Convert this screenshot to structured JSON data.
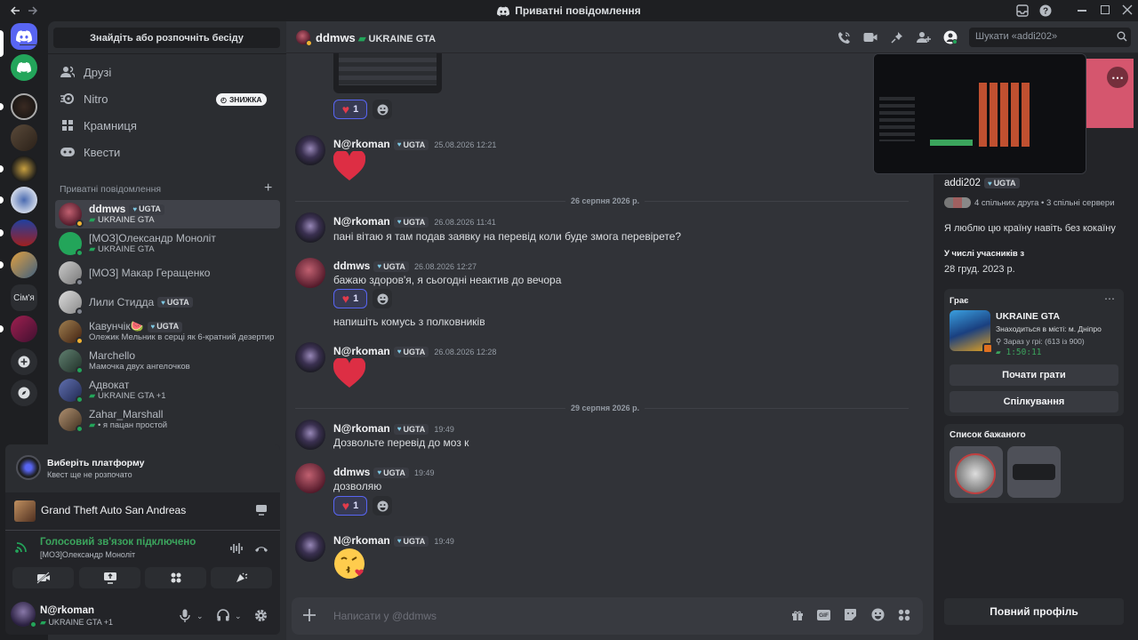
{
  "window": {
    "title": "Приватні повідомлення"
  },
  "sidebar": {
    "search_label": "Знайдіть або розпочніть бесіду",
    "nav": [
      {
        "label": "Друзі",
        "icon": "friends-icon"
      },
      {
        "label": "Nitro",
        "icon": "nitro-icon",
        "badge": "ЗНИЖКА"
      },
      {
        "label": "Крамниця",
        "icon": "shop-icon"
      },
      {
        "label": "Квести",
        "icon": "quests-icon"
      }
    ],
    "dm_header": "Приватні повідомлення",
    "dm_list": [
      {
        "name": "ddmws",
        "tag": "UGTA",
        "sub": "UKRAINE GTA"
      },
      {
        "name": "[МОЗ]Олександр Моноліт",
        "sub": "UKRAINE GTA"
      },
      {
        "name": "[МОЗ] Макар Геращенко"
      },
      {
        "name": "Лили Стидда",
        "tag": "UGTA"
      },
      {
        "name": "Кавунчік🍉",
        "tag": "UGTA",
        "sub": "Олежик Мельник в серці як 6-кратний дезертир"
      },
      {
        "name": "Marchello",
        "sub": "Мамочка двух ангелочков"
      },
      {
        "name": "Адвокат",
        "sub": "UKRAINE GTA +1"
      },
      {
        "name": "Zahar_Marshall",
        "sub": "• я пацан простой"
      }
    ],
    "quest": {
      "title": "Виберіть платформу",
      "sub": "Квест ще не розпочато"
    },
    "game": {
      "title": "Grand Theft Auto San Andreas"
    },
    "voice": {
      "status": "Голосовий зв'язок підключено",
      "channel": "[МОЗ]Олександр Моноліт"
    },
    "user": {
      "name": "N@rkoman",
      "sub": "UKRAINE GTA +1"
    }
  },
  "guilds": {
    "folder_label": "Сім'я"
  },
  "header": {
    "name": "ddmws",
    "activity": "UKRAINE GTA",
    "search_placeholder": "Шукати «addi202»"
  },
  "messages": {
    "m1": {
      "author": "N@rkoman",
      "tag": "UGTA",
      "time": "25.08.2026 12:21"
    },
    "div1": "26 серпня 2026 р.",
    "m2": {
      "author": "N@rkoman",
      "tag": "UGTA",
      "time": "26.08.2026 11:41",
      "text": "пані вітаю я там подав заявку на перевід коли буде змога перевірете?"
    },
    "m3": {
      "author": "ddmws",
      "tag": "UGTA",
      "time": "26.08.2026 12:27",
      "text": "бажаю здоров'я, я сьогодні неактив до вечора",
      "text2": "напишіть комусь з полковників"
    },
    "m4": {
      "author": "N@rkoman",
      "tag": "UGTA",
      "time": "26.08.2026 12:28"
    },
    "div2": "29 серпня 2026 р.",
    "m5": {
      "author": "N@rkoman",
      "tag": "UGTA",
      "time": "19:49",
      "text": "Дозвольте перевід до моз к"
    },
    "m6": {
      "author": "ddmws",
      "tag": "UGTA",
      "time": "19:49",
      "text": "дозволяю"
    },
    "m7": {
      "author": "N@rkoman",
      "tag": "UGTA",
      "time": "19:49"
    },
    "reaction_count": "1"
  },
  "composer": {
    "placeholder": "Написати у @ddmws"
  },
  "profile": {
    "username": "addi202",
    "tag": "UGTA",
    "mutuals": "4 спільних друга • 3 спільні сервери",
    "bio": "Я люблю цю країну навіть без кокаїну",
    "member_since_label": "У числі учасників з",
    "member_since": "28 груд. 2023 р.",
    "playing_label": "Грає",
    "game_title": "UKRAINE GTA",
    "game_line1": "Знаходиться в місті: м. Дніпро",
    "game_line2": "Зараз у грі: (613 із 900)",
    "game_timer": "1:50:11",
    "play_button": "Почати грати",
    "chat_button": "Спілкування",
    "wishlist_label": "Список бажаного",
    "full_profile": "Повний профіль"
  },
  "colors": {
    "accent": "#5865f2",
    "online": "#23a55a",
    "idle": "#f0b232",
    "green_text": "#3ba55d"
  }
}
